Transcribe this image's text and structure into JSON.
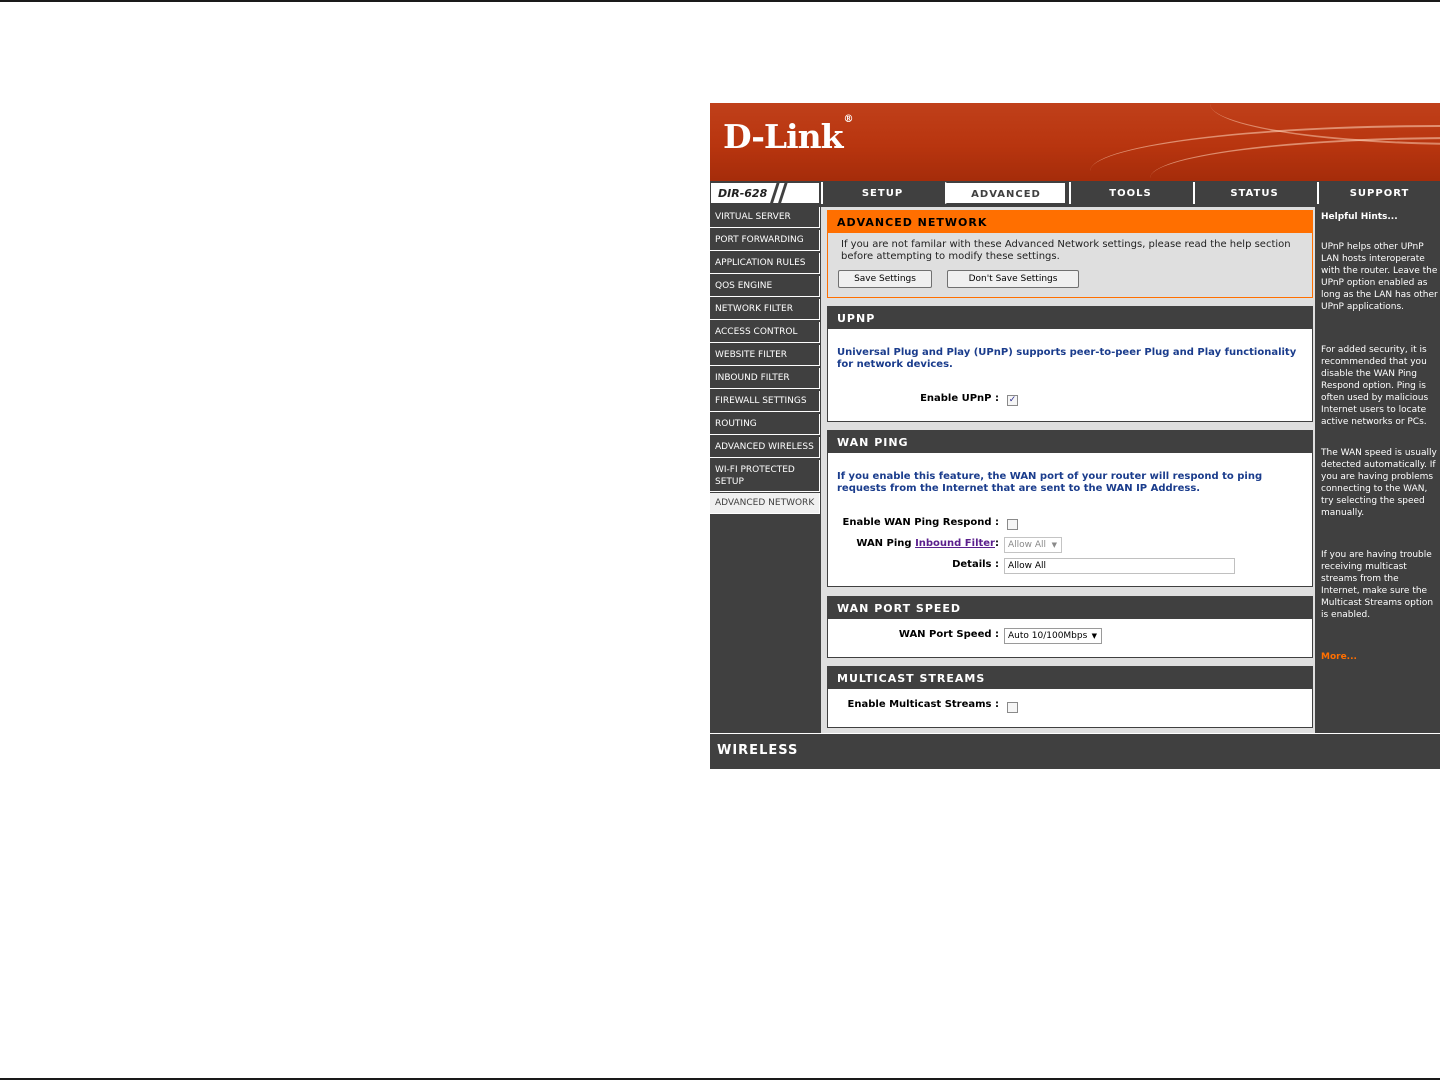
{
  "brand": {
    "logo_text": "D-Link",
    "logo_mark": "®",
    "model": "DIR-628",
    "footer": "WIRELESS"
  },
  "tabs": [
    {
      "label": "SETUP"
    },
    {
      "label": "ADVANCED"
    },
    {
      "label": "TOOLS"
    },
    {
      "label": "STATUS"
    },
    {
      "label": "SUPPORT"
    }
  ],
  "menu": [
    {
      "label": "VIRTUAL SERVER"
    },
    {
      "label": "PORT FORWARDING"
    },
    {
      "label": "APPLICATION RULES"
    },
    {
      "label": "QOS ENGINE"
    },
    {
      "label": "NETWORK FILTER"
    },
    {
      "label": "ACCESS CONTROL"
    },
    {
      "label": "WEBSITE FILTER"
    },
    {
      "label": "INBOUND FILTER"
    },
    {
      "label": "FIREWALL SETTINGS"
    },
    {
      "label": "ROUTING"
    },
    {
      "label": "ADVANCED WIRELESS"
    },
    {
      "label": "WI-FI PROTECTED SETUP"
    },
    {
      "label": "ADVANCED NETWORK"
    }
  ],
  "advanced_network": {
    "title": "ADVANCED NETWORK",
    "intro": "If you are not familar with these Advanced Network settings, please read the help section before attempting to modify these settings.",
    "save_label": "Save Settings",
    "dont_save_label": "Don't Save Settings"
  },
  "upnp": {
    "title": "UPNP",
    "description": "Universal Plug and Play (UPnP) supports peer-to-peer Plug and Play functionality for network devices.",
    "enable_label": "Enable UPnP :",
    "enabled": true
  },
  "wan_ping": {
    "title": "WAN PING",
    "description": "If you enable this feature, the WAN port of your router will respond to ping requests from the Internet that are sent to the WAN IP Address.",
    "enable_label": "Enable WAN Ping Respond :",
    "enabled": false,
    "filter_label_prefix": "WAN Ping",
    "filter_link": "Inbound Filter",
    "filter_label_suffix": ":",
    "filter_value": "Allow All",
    "details_label": "Details :",
    "details_value": "Allow All"
  },
  "wan_port_speed": {
    "title": "WAN PORT SPEED",
    "label": "WAN Port Speed :",
    "value": "Auto 10/100Mbps"
  },
  "multicast": {
    "title": "MULTICAST STREAMS",
    "enable_label": "Enable Multicast Streams :",
    "enabled": false
  },
  "hints": {
    "title": "Helpful Hints...",
    "items": [
      "UPnP helps other UPnP LAN hosts interoperate with the router. Leave the UPnP option enabled as long as the LAN has other UPnP applications.",
      "For added security, it is recommended that you disable the WAN Ping Respond option. Ping is often used by malicious Internet users to locate active networks or PCs.",
      "The WAN speed is usually detected automatically. If you are having problems connecting to the WAN, try selecting the speed manually.",
      "If you are having trouble receiving multicast streams from the Internet, make sure the Multicast Streams option is enabled."
    ],
    "more": "More..."
  },
  "colors": {
    "accent": "#ff6f00",
    "banner": "#b8350f",
    "chrome": "#404040",
    "panel": "#dfdfdf",
    "description_text": "#1a3c8c"
  }
}
